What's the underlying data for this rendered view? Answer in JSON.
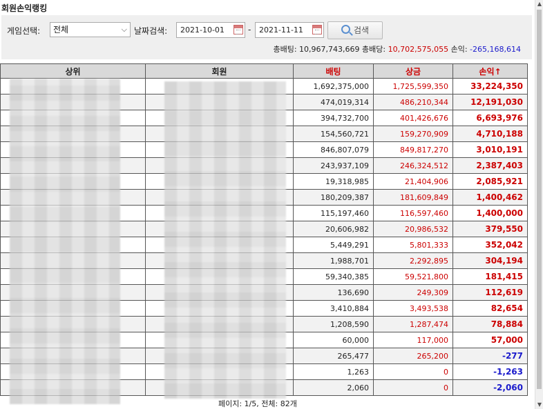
{
  "page_title": "회원손익랭킹",
  "search": {
    "game_label": "게임선택:",
    "game_value": "전체",
    "date_label": "날짜검색:",
    "date_from": "2021-10-01",
    "date_separator": "-",
    "date_to": "2021-11-11",
    "search_button": "검색"
  },
  "totals": {
    "bet_label": "총배팅:",
    "bet_value": "10,967,743,669",
    "win_label": "총배당:",
    "win_value": "10,702,575,055",
    "pl_label": "손익:",
    "pl_value": "-265,168,614"
  },
  "table": {
    "headers": {
      "parent": "상위",
      "member": "회원",
      "bet": "배팅",
      "win": "상금",
      "pl": "손익↑"
    },
    "rows": [
      {
        "bet": "1,692,375,000",
        "win": "1,725,599,350",
        "pl": "33,224,350"
      },
      {
        "bet": "474,019,314",
        "win": "486,210,344",
        "pl": "12,191,030"
      },
      {
        "bet": "394,732,700",
        "win": "401,426,676",
        "pl": "6,693,976"
      },
      {
        "bet": "154,560,721",
        "win": "159,270,909",
        "pl": "4,710,188"
      },
      {
        "bet": "846,807,079",
        "win": "849,817,270",
        "pl": "3,010,191"
      },
      {
        "bet": "243,937,109",
        "win": "246,324,512",
        "pl": "2,387,403"
      },
      {
        "bet": "19,318,985",
        "win": "21,404,906",
        "pl": "2,085,921"
      },
      {
        "bet": "180,209,387",
        "win": "181,609,849",
        "pl": "1,400,462"
      },
      {
        "bet": "115,197,460",
        "win": "116,597,460",
        "pl": "1,400,000"
      },
      {
        "bet": "20,606,982",
        "win": "20,986,532",
        "pl": "379,550"
      },
      {
        "bet": "5,449,291",
        "win": "5,801,333",
        "pl": "352,042"
      },
      {
        "bet": "1,988,701",
        "win": "2,292,895",
        "pl": "304,194"
      },
      {
        "bet": "59,340,385",
        "win": "59,521,800",
        "pl": "181,415"
      },
      {
        "bet": "136,690",
        "win": "249,309",
        "pl": "112,619"
      },
      {
        "bet": "3,410,884",
        "win": "3,493,538",
        "pl": "82,654"
      },
      {
        "bet": "1,208,590",
        "win": "1,287,474",
        "pl": "78,884"
      },
      {
        "bet": "60,000",
        "win": "117,000",
        "pl": "57,000"
      },
      {
        "bet": "265,477",
        "win": "265,200",
        "pl": "-277"
      },
      {
        "bet": "1,263",
        "win": "0",
        "pl": "-1,263"
      },
      {
        "bet": "2,060",
        "win": "0",
        "pl": "-2,060"
      }
    ]
  },
  "pager_text": "페이지: 1/5, 전체: 82개",
  "colors": {
    "positive": "#cc0000",
    "negative": "#1a1acc",
    "header_bg": "#d9d9d9"
  }
}
